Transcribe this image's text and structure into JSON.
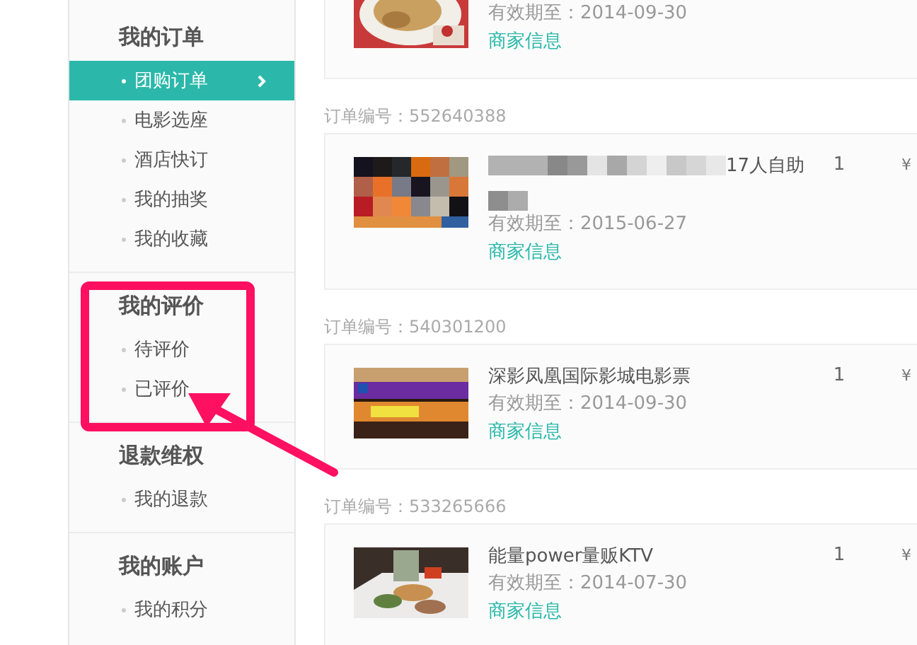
{
  "sidebar": {
    "sections": [
      {
        "heading": "我的订单",
        "items": [
          {
            "label": "团购订单",
            "selected": true
          },
          {
            "label": "电影选座",
            "selected": false
          },
          {
            "label": "酒店快订",
            "selected": false
          },
          {
            "label": "我的抽奖",
            "selected": false
          },
          {
            "label": "我的收藏",
            "selected": false
          }
        ]
      },
      {
        "heading": "我的评价",
        "items": [
          {
            "label": "待评价",
            "selected": false
          },
          {
            "label": "已评价",
            "selected": false
          }
        ]
      },
      {
        "heading": "退款维权",
        "items": [
          {
            "label": "我的退款",
            "selected": false
          }
        ]
      },
      {
        "heading": "我的账户",
        "items": [
          {
            "label": "我的积分",
            "selected": false
          }
        ]
      }
    ]
  },
  "orders": [
    {
      "kind": "partial",
      "valid_until": "有效期至：2014-09-30",
      "merchant_link": "商家信息"
    },
    {
      "kind": "redacted",
      "order_number": "订单编号：552640388",
      "title": "17人自助",
      "valid_until": "有效期至：2015-06-27",
      "merchant_link": "商家信息",
      "quantity": "1",
      "price_column": [
        "¥"
      ]
    },
    {
      "kind": "full",
      "order_number": "订单编号：540301200",
      "title": "深影凤凰国际影城电影票",
      "valid_until": "有效期至：2014-09-30",
      "merchant_link": "商家信息",
      "quantity": "1",
      "price_column": [
        "¥"
      ]
    },
    {
      "kind": "full",
      "order_number": "订单编号：533265666",
      "title": "能量power量贩KTV",
      "valid_until": "有效期至：2014-07-30",
      "merchant_link": "商家信息",
      "quantity": "1",
      "price_column": [
        "¥"
      ]
    }
  ]
}
